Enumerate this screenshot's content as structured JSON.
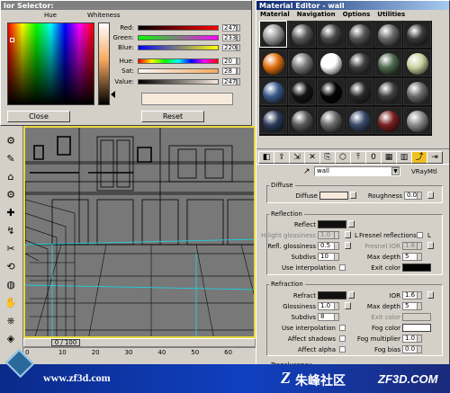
{
  "color_selector": {
    "title": "lor Selector:",
    "hue_label": "Hue",
    "whiteness_label": "Whiteness",
    "channels": [
      {
        "name": "Red:",
        "value": "247",
        "gradient": "linear-gradient(90deg,#000,#ff0000)"
      },
      {
        "name": "Green:",
        "value": "233",
        "gradient": "linear-gradient(90deg,#00ff00,#ff00ff)"
      },
      {
        "name": "Blue:",
        "value": "220",
        "gradient": "linear-gradient(90deg,#0000ff,#ffff00)"
      },
      {
        "name": "Hue:",
        "value": "20",
        "gradient": "linear-gradient(90deg,#f00,#ff0,#0f0,#0ff,#00f,#f0f,#f00)"
      },
      {
        "name": "Sat:",
        "value": "28",
        "gradient": "linear-gradient(90deg,#f7f7f7,#f7a860)"
      },
      {
        "name": "Value:",
        "value": "247",
        "gradient": "linear-gradient(90deg,#000,#f7e9dc)"
      }
    ],
    "current_color": "#f7e9dc",
    "close_label": "Close",
    "reset_label": "Reset"
  },
  "material_editor": {
    "title": "Material Editor - wall",
    "menu": [
      "Material",
      "Navigation",
      "Options",
      "Utilities"
    ],
    "material_name": "wall",
    "material_type": "VRayMtl",
    "toolbar_icons": [
      "get-material-icon",
      "put-to-scene-icon",
      "assign-icon",
      "reset-icon",
      "copy-icon",
      "unique-icon",
      "put-library-icon",
      "effects-channel-icon",
      "show-map-icon",
      "show-end-icon",
      "go-parent-icon",
      "go-sibling-icon"
    ],
    "slot_colors": [
      [
        "#9a9a9a",
        "#5a5a5a",
        "#4a4a4a",
        "#555555",
        "#6a6a6a",
        "#3a3a3a"
      ],
      [
        "#e07010",
        "#7a7a7a",
        "#ffffff",
        "#3f3f3f",
        "#4f6a4f",
        "#c9d2a0"
      ],
      [
        "#3a5a8a",
        "#141414",
        "#050505",
        "#2a2a2a",
        "#404040",
        "#6a6a6a"
      ],
      [
        "#2a3a5a",
        "#5a5a5a",
        "#6a6a6a",
        "#3a4a6a",
        "#7a2020",
        "#8a8a8a"
      ]
    ],
    "diffuse": {
      "group": "Diffuse",
      "diffuse_label": "Diffuse",
      "diffuse_color": "#f7e9dc",
      "roughness_label": "Roughness",
      "roughness_value": "0.0"
    },
    "reflection": {
      "group": "Reflection",
      "reflect_label": "Reflect",
      "reflect_color": "#101010",
      "hilight_label": "Hilight glossiness",
      "hilight_value": "1.0",
      "lock_label": "L",
      "fresnel_label": "Fresnel reflections",
      "fresnel_ior_label": "Fresnel IOR",
      "fresnel_ior_value": "1.6",
      "refl_gloss_label": "Refl. glossiness",
      "refl_gloss_value": "0.5",
      "max_depth_label": "Max depth",
      "max_depth_value": "5",
      "subdivs_label": "Subdivs",
      "subdivs_value": "10",
      "exit_color_label": "Exit color",
      "exit_color": "#000000",
      "use_interp_label": "Use interpolation"
    },
    "refraction": {
      "group": "Refraction",
      "refract_label": "Refract",
      "refract_color": "#101010",
      "ior_label": "IOR",
      "ior_value": "1.6",
      "glossiness_label": "Glossiness",
      "glossiness_value": "1.0",
      "max_depth_label": "Max depth",
      "max_depth_value": "5",
      "subdivs_label": "Subdivs",
      "subdivs_value": "8",
      "exit_color_label": "Exit color",
      "use_interp_label": "Use interpolation",
      "fog_color_label": "Fog color",
      "affect_shadows_label": "Affect shadows",
      "fog_mult_label": "Fog multiplier",
      "fog_mult_value": "1.0",
      "affect_alpha_label": "Affect alpha",
      "fog_bias_label": "Fog bias",
      "fog_bias_value": "0.0"
    },
    "translucency_label": "Translucency"
  },
  "viewport": {
    "frame_counter": "0 / 100",
    "ruler_ticks": [
      "0",
      "10",
      "20",
      "30",
      "40",
      "50",
      "60"
    ]
  },
  "watermark": {
    "url": "www.zf3d.com",
    "brand_cn": "朱峰社区",
    "brand_en": "ZF3D.COM"
  }
}
